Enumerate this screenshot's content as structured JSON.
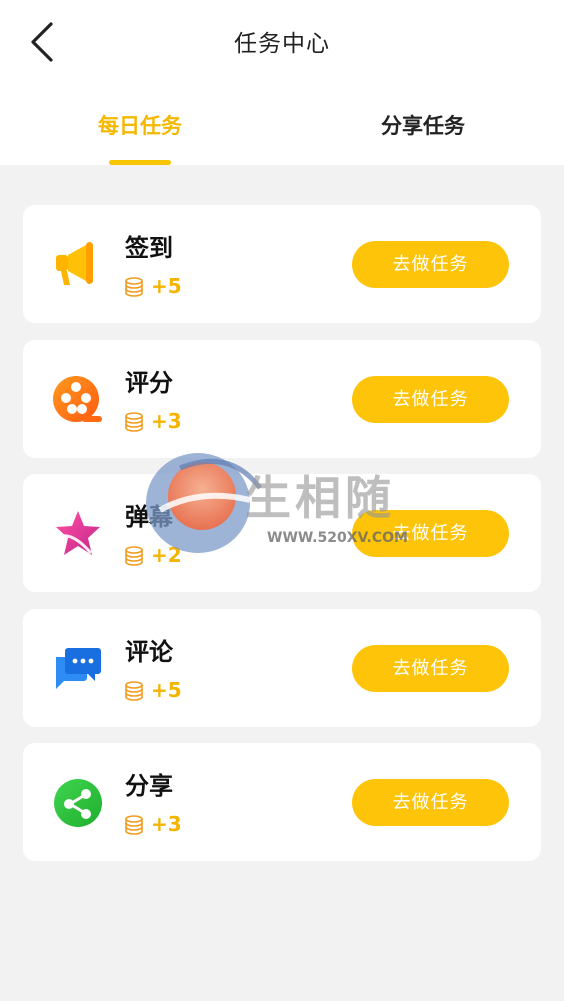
{
  "header": {
    "title": "任务中心",
    "back_icon": "chevron-left-icon"
  },
  "tabs": [
    {
      "label": "每日任务",
      "active": true
    },
    {
      "label": "分享任务",
      "active": false
    }
  ],
  "colors": {
    "accent": "#fdc40a",
    "active_tab": "#f5b800",
    "reward": "#f5b400",
    "background": "#f2f2f2"
  },
  "tasks": [
    {
      "name": "签到",
      "reward": "+5",
      "button": "去做任务",
      "icon": "megaphone-icon"
    },
    {
      "name": "评分",
      "reward": "+3",
      "button": "去做任务",
      "icon": "film-reel-icon"
    },
    {
      "name": "弹幕",
      "reward": "+2",
      "button": "去做任务",
      "icon": "star-icon"
    },
    {
      "name": "评论",
      "reward": "+5",
      "button": "去做任务",
      "icon": "chat-bubbles-icon"
    },
    {
      "name": "分享",
      "reward": "+3",
      "button": "去做任务",
      "icon": "share-icon"
    }
  ],
  "watermark": {
    "text": "生相随",
    "url": "WWW.520XV.COM"
  }
}
